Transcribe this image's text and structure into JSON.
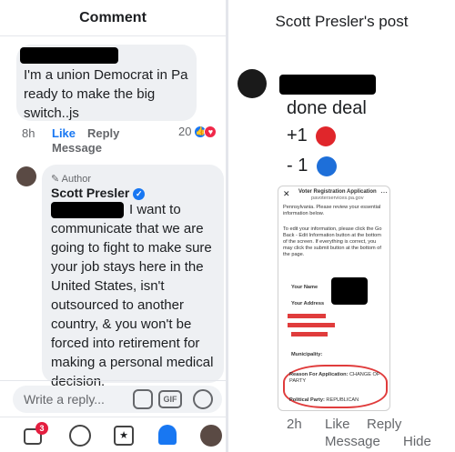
{
  "left": {
    "header_title": "Comment",
    "comment1": {
      "text": "I'm a union Democrat in Pa ready to make the big switch..js",
      "time": "8h",
      "like": "Like",
      "reply": "Reply",
      "message": "Message",
      "reaction_count": "20"
    },
    "comment2": {
      "author_badge": "Author",
      "author_name": "Scott Presler",
      "text_line1": "I want to",
      "text_rest": "communicate that we are going to fight to make sure your job stays here in the United States, isn't outsourced to another country, & you won't be forced into retirement for making a personal medical decision."
    },
    "composer": {
      "placeholder": "Write a reply...",
      "gif_label": "GIF"
    },
    "tabbar": {
      "notification_count": "3"
    }
  },
  "right": {
    "header_title": "Scott Presler's post",
    "comment": {
      "line1": "done deal",
      "line2": "+1",
      "line3": "- 1",
      "time": "2h",
      "like": "Like",
      "reply": "Reply",
      "message": "Message",
      "hide": "Hide"
    },
    "form": {
      "title": "Voter Registration Application",
      "url": "pavoterservices.pa.gov",
      "intro": "Pennsylvania. Please review your essential information below.",
      "instructions": "To edit your information, please click the Go Back - Edit Information button at the bottom of the screen. If everything is correct, you may click the submit button at the bottom of the page.",
      "your_name": "Your Name",
      "your_address": "Your Address",
      "municipality": "Municipality:",
      "reason_label": "Reason For Application:",
      "reason_value": "CHANGE OF PARTY",
      "party_label": "Political Party:",
      "party_value": "REPUBLICAN"
    }
  },
  "colors": {
    "facebook_blue": "#1877f2",
    "red_circle": "#e0262b",
    "blue_circle": "#1e6fd9",
    "annotation_red": "#e03c3c"
  }
}
